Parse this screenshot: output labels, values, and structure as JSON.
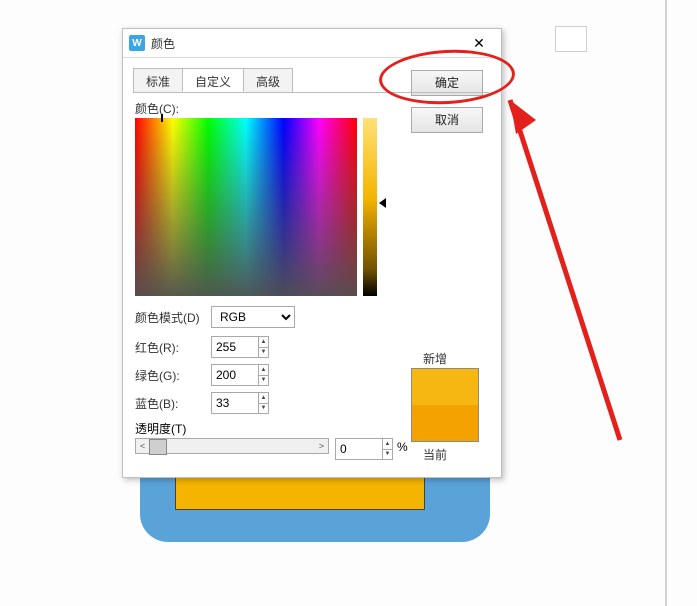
{
  "titlebar": {
    "icon_letter": "W",
    "title": "颜色"
  },
  "tabs": {
    "items": [
      {
        "label": "标准"
      },
      {
        "label": "自定义"
      },
      {
        "label": "高级"
      }
    ],
    "active_index": 1
  },
  "buttons": {
    "ok": "确定",
    "cancel": "取消"
  },
  "color_section_label": "颜色(C):",
  "mode": {
    "label": "颜色模式(D)",
    "value": "RGB"
  },
  "channels": {
    "red": {
      "label": "红色(R):",
      "value": "255"
    },
    "green": {
      "label": "绿色(G):",
      "value": "200"
    },
    "blue": {
      "label": "蓝色(B):",
      "value": "33"
    }
  },
  "opacity": {
    "label": "透明度(T)",
    "value": "0",
    "unit": "%"
  },
  "preview": {
    "new_label": "新增",
    "current_label": "当前",
    "new_color": "#f7b713",
    "current_color": "#f4a200"
  }
}
